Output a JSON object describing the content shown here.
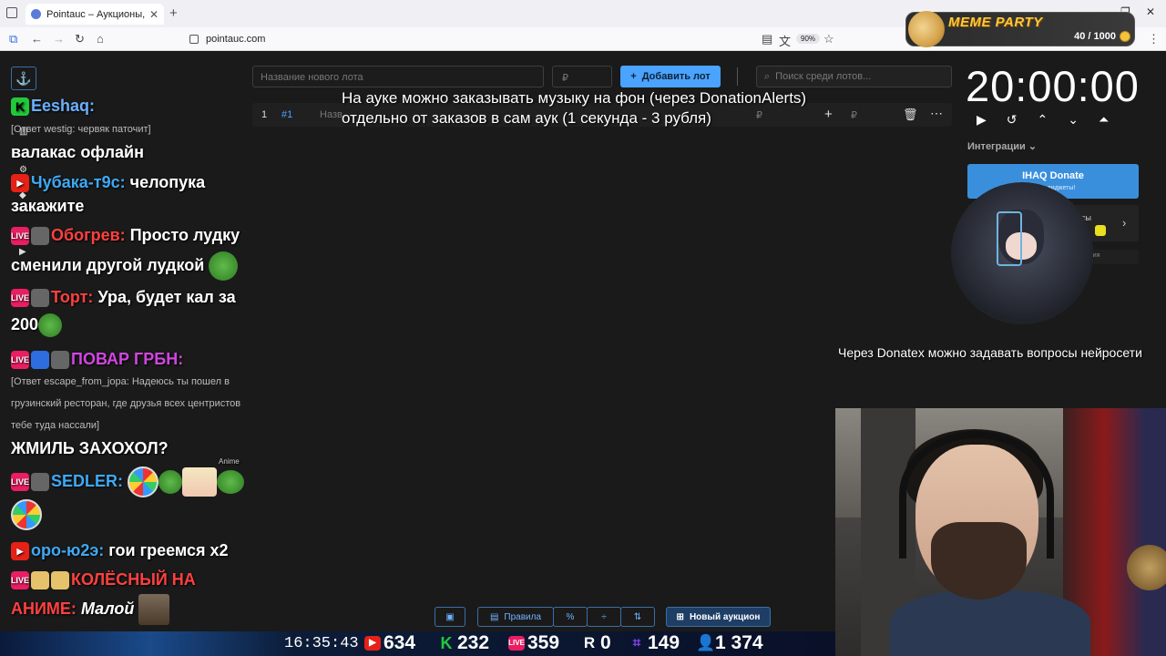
{
  "browser": {
    "tab_title": "Pointauc – Аукционы, лотереи",
    "url": "pointauc.com",
    "zoom": "90%"
  },
  "meme_party": {
    "title": "MEME PARTY",
    "count": "40 / 1000"
  },
  "auction": {
    "new_lot_placeholder": "Название нового лота",
    "amount_placeholder": "₽",
    "add_lot_label": "Добавить лот",
    "search_placeholder": "Поиск среди лотов...",
    "lot": {
      "index": "1",
      "id": "#1",
      "name": "Назв",
      "currency": "₽",
      "currency2": "₽"
    },
    "overlay_line1": "На ауке можно заказывать музыку на фон (через DonationAlerts)",
    "overlay_line2": "отдельно от заказов в сам аук (1 секунда - 3 рубля)"
  },
  "timer": {
    "value": "20:00:00",
    "integrations_label": "Интеграции",
    "ihaq_title": "IHAQ Donate",
    "ihaq_sub": "ьные виджеты!",
    "card2_text": "исы",
    "card3_text": "ория"
  },
  "donatex_text": "Через Donatex можно задавать вопросы нейросети",
  "chat": [
    {
      "user": "Eeshaq:",
      "user_color": "#6ab0ff",
      "text": ""
    },
    {
      "reply": "[Ответ westig: червяк паточит]"
    },
    {
      "text": "валакас офлайн"
    },
    {
      "user": "Чубака-т9с:",
      "user_color": "#3fa9f5",
      "text": " челопука"
    },
    {
      "text": "закажите"
    },
    {
      "user": "Обогрев:",
      "user_color": "#ff4040",
      "text": " Просто лудку"
    },
    {
      "text": "сменили другой лудкой"
    },
    {
      "user": "Торт:",
      "user_color": "#ff4040",
      "text": " Ура, будет кал за"
    },
    {
      "text": "200"
    },
    {
      "user": "ПОВАР ГРБН:",
      "user_color": "#d046e0",
      "text": ""
    },
    {
      "reply": "[Ответ escape_from_jopa: Надеюсь ты пошел в"
    },
    {
      "reply": "грузинский ресторан, где друзья всех центристов"
    },
    {
      "reply": "тебе туда нассали]"
    },
    {
      "text": "ЖМИЛЬ ЗАХОХОЛ?"
    },
    {
      "user": "SEDLER:",
      "user_color": "#3fa9f5",
      "text": ""
    },
    {
      "user": "оро-ю2э:",
      "user_color": "#3fa9f5",
      "text": " гои греемся х2"
    },
    {
      "user": "КОЛЁСНЫЙ НА",
      "user_color": "#ff4040",
      "text": ""
    },
    {
      "user": "АНИМЕ:",
      "user_color": "#ff4040",
      "text": " Малой"
    }
  ],
  "emote_labels": {
    "anime": "Anime"
  },
  "toolbar": {
    "rules_label": "Правила",
    "new_auction_label": "Новый аукцион"
  },
  "stats": {
    "clock": "16:35:43",
    "youtube": "634",
    "kick": "232",
    "vk_live": "359",
    "r": "0",
    "twitch": "149",
    "total": "1 374",
    "r_label": "R"
  },
  "colors": {
    "accent": "#4aa3ff",
    "page_bg": "#1a1a1a"
  }
}
